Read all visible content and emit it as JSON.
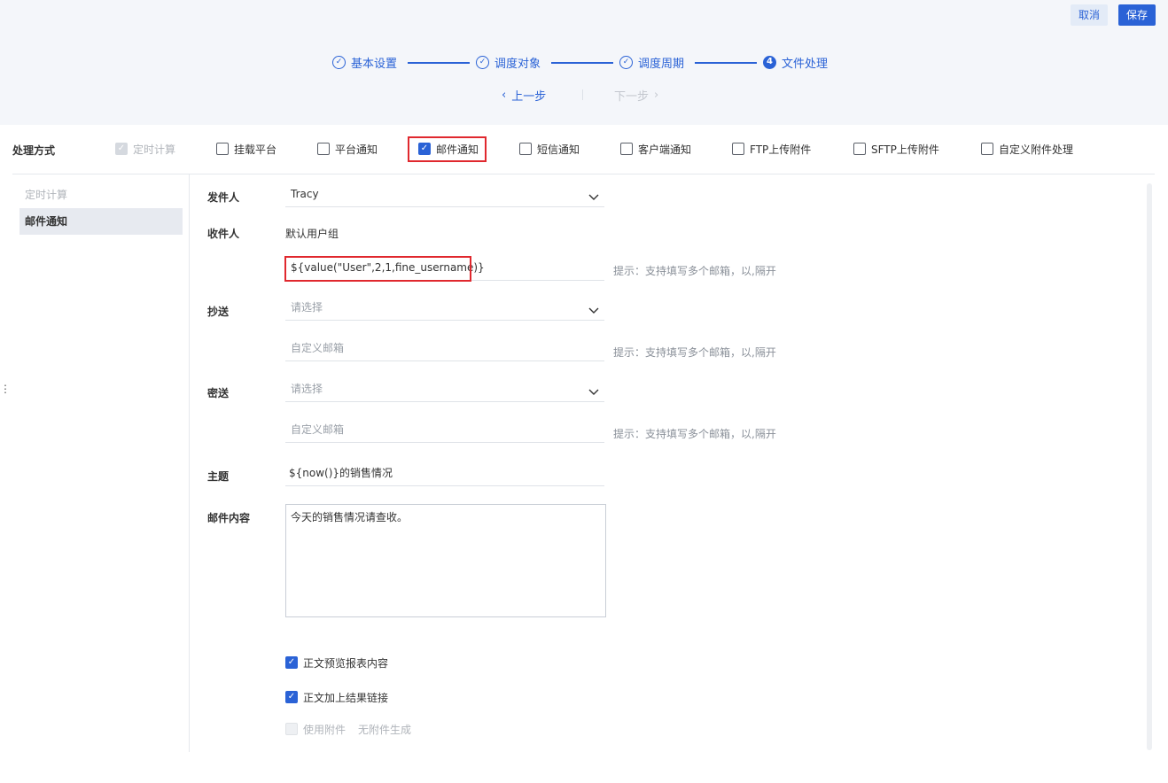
{
  "header": {
    "cancel_label": "取消",
    "save_label": "保存",
    "steps": [
      {
        "label": "基本设置",
        "state": "done"
      },
      {
        "label": "调度对象",
        "state": "done"
      },
      {
        "label": "调度周期",
        "state": "done"
      },
      {
        "label": "文件处理",
        "state": "current",
        "number": "4"
      }
    ],
    "prev_label": "上一步",
    "next_label": "下一步"
  },
  "options": {
    "label": "处理方式",
    "items": [
      {
        "label": "定时计算",
        "checked": true,
        "disabled": true
      },
      {
        "label": "挂载平台",
        "checked": false
      },
      {
        "label": "平台通知",
        "checked": false
      },
      {
        "label": "邮件通知",
        "checked": true
      },
      {
        "label": "短信通知",
        "checked": false
      },
      {
        "label": "客户端通知",
        "checked": false
      },
      {
        "label": "FTP上传附件",
        "checked": false
      },
      {
        "label": "SFTP上传附件",
        "checked": false
      },
      {
        "label": "自定义附件处理",
        "checked": false
      }
    ]
  },
  "sidebar": {
    "items": [
      {
        "label": "定时计算",
        "state": "disabled"
      },
      {
        "label": "邮件通知",
        "state": "active"
      }
    ]
  },
  "form": {
    "sender_label": "发件人",
    "sender_value": "Tracy",
    "recipient_label": "收件人",
    "recipient_group": "默认用户组",
    "recipient_formula": "${value(\"User\",2,1,fine_username)}",
    "hint": "提示：支持填写多个邮箱，以,隔开",
    "cc_label": "抄送",
    "bcc_label": "密送",
    "select_placeholder": "请选择",
    "custom_email_placeholder": "自定义邮箱",
    "subject_label": "主题",
    "subject_value": "${now()}的销售情况",
    "content_label": "邮件内容",
    "content_value": "今天的销售情况请查收。",
    "preview_label": "正文预览报表内容",
    "link_label": "正文加上结果链接",
    "attach_label": "使用附件",
    "attach_note": "无附件生成"
  }
}
